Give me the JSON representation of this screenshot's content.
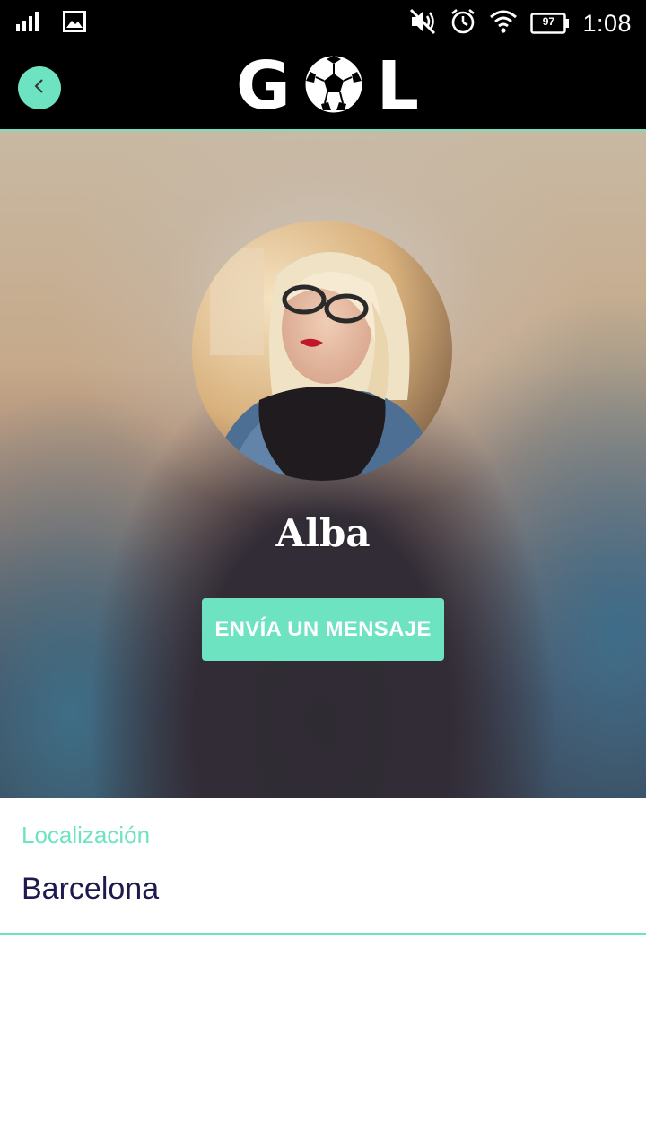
{
  "status_bar": {
    "time": "1:08",
    "battery": "97",
    "icons": [
      "signal-icon",
      "image-notification-icon",
      "mute-icon",
      "alarm-icon",
      "wifi-icon",
      "battery-icon"
    ]
  },
  "app_bar": {
    "back_icon": "chevron-left-icon",
    "logo_text_left": "G",
    "logo_text_right": "L",
    "logo_icon": "soccer-ball-icon"
  },
  "profile": {
    "name": "Alba",
    "message_button": "ENVÍA UN MENSAJE"
  },
  "details": {
    "location_label": "Localización",
    "location_value": "Barcelona"
  },
  "colors": {
    "accent": "#6ee3c1",
    "location_text": "#1f1a4d",
    "bar_background": "#000000"
  }
}
